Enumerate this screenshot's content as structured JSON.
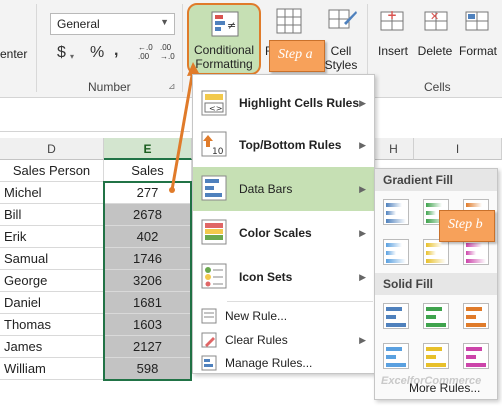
{
  "ribbon": {
    "alignment_fragment": "enter",
    "number_format": "General",
    "number_group_label": "Number",
    "currency_symbol": "$",
    "percent_symbol": "%",
    "comma_symbol": ",",
    "increase_decimal": "←.0\n.00",
    "decrease_decimal": ".00\n→.0",
    "conditional_formatting_label": "Conditional",
    "conditional_formatting_label2": "Formatting",
    "cell_styles_label": "Cell",
    "cell_styles_label2": "Styles",
    "insert_label": "Insert",
    "delete_label": "Delete",
    "format_label": "Format",
    "cells_group_label": "Cells"
  },
  "callouts": {
    "step_a": "Step a",
    "step_b": "Step b"
  },
  "sheet": {
    "columns": [
      "D",
      "E",
      "H",
      "I"
    ],
    "header_row": {
      "name": "Sales Person",
      "value": "Sales"
    },
    "rows": [
      {
        "name": "Michel",
        "value": "277"
      },
      {
        "name": "Bill",
        "value": "2678"
      },
      {
        "name": "Erik",
        "value": "402"
      },
      {
        "name": "Samual",
        "value": "1746"
      },
      {
        "name": "George",
        "value": "3206"
      },
      {
        "name": "Daniel",
        "value": "1681"
      },
      {
        "name": "Thomas",
        "value": "1603"
      },
      {
        "name": "James",
        "value": "2127"
      },
      {
        "name": "William",
        "value": "598"
      }
    ]
  },
  "menu": {
    "items": [
      {
        "label": "Highlight Cells Rules",
        "bold": true,
        "has_submenu": true
      },
      {
        "label": "Top/Bottom Rules",
        "bold": true,
        "has_submenu": true
      },
      {
        "label": "Data Bars",
        "bold": true,
        "has_submenu": true,
        "active": true
      },
      {
        "label": "Color Scales",
        "bold": true,
        "has_submenu": true
      },
      {
        "label": "Icon Sets",
        "bold": true,
        "has_submenu": true
      }
    ],
    "small_items": [
      {
        "label": "New Rule..."
      },
      {
        "label": "Clear Rules",
        "has_submenu": true
      },
      {
        "label": "Manage Rules..."
      }
    ]
  },
  "submenu": {
    "gradient_fill_label": "Gradient Fill",
    "solid_fill_label": "Solid Fill",
    "more_rules_label": "More Rules...",
    "watermark": "ExcelforCommerce",
    "bar_colors": [
      "#4f81bd",
      "#3fa34d",
      "#e07b2a",
      "#5aa0e0",
      "#e8c02a",
      "#cc44aa"
    ]
  },
  "colors": {
    "selection_green": "#c6e0b4",
    "callout_orange": "#f7a15a",
    "arrow_orange": "#e07b2a"
  }
}
